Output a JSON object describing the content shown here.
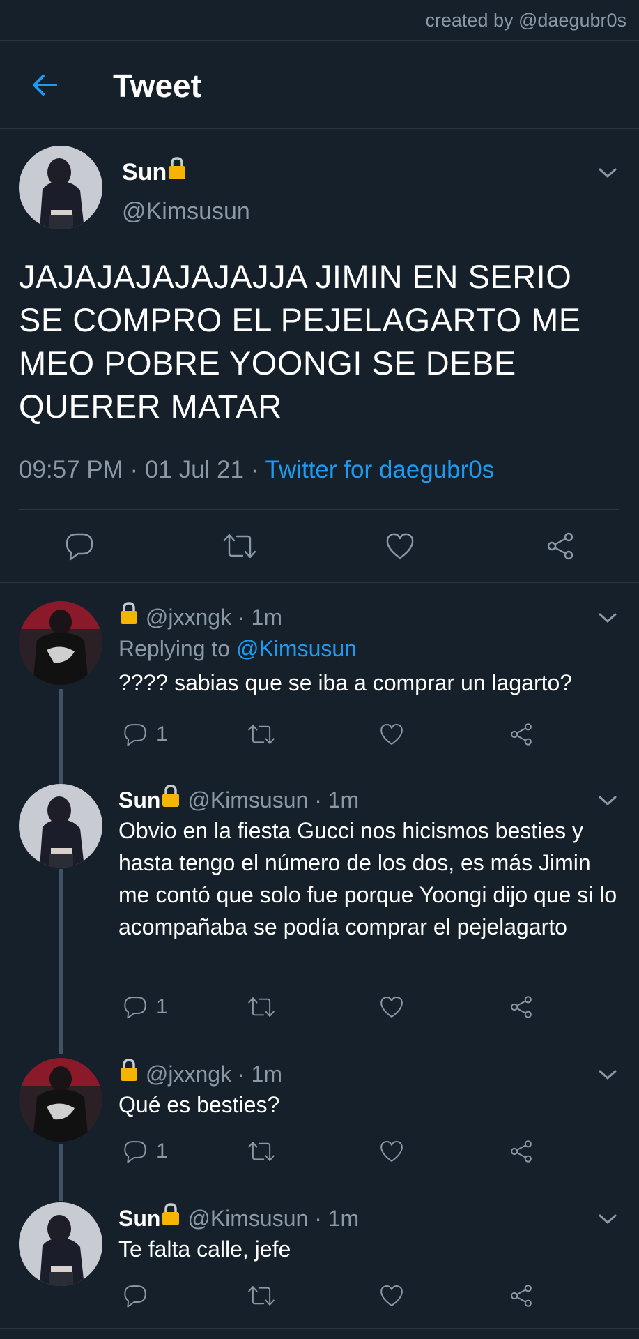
{
  "credit": "created by @daegubr0s",
  "header": {
    "title": "Tweet"
  },
  "main_tweet": {
    "name": "Sun",
    "handle": "@Kimsusun",
    "text": "JAJAJAJAJAJAJJA JIMIN EN SERIO SE COMPRO EL PEJELAGARTO ME MEO POBRE YOONGI SE DEBE QUERER MATAR",
    "time": "09:57 PM",
    "date": "01 Jul 21",
    "source": "Twitter for daegubr0s"
  },
  "replies": [
    {
      "name": "",
      "handle": "@jxxngk",
      "age": "1m",
      "replying_label": "Replying to",
      "replying_to": "@Kimsusun",
      "text": "???? sabias que se iba a comprar un lagarto?",
      "reply_count": "1"
    },
    {
      "name": "Sun",
      "handle": "@Kimsusun",
      "age": "1m",
      "text": "Obvio en la fiesta Gucci nos hicismos besties y hasta tengo el número de los dos, es más Jimin me contó que solo fue porque Yoongi dijo que si lo acompañaba se podía comprar el pejelagarto",
      "reply_count": "1"
    },
    {
      "name": "",
      "handle": "@jxxngk",
      "age": "1m",
      "text": "Qué es besties?",
      "reply_count": "1"
    },
    {
      "name": "Sun",
      "handle": "@Kimsusun",
      "age": "1m",
      "text": "Te falta calle, jefe",
      "reply_count": ""
    }
  ],
  "icons": {
    "back": "arrow-left-icon",
    "lock": "lock-icon",
    "more": "chevron-down-icon",
    "reply": "reply-icon",
    "retweet": "retweet-icon",
    "like": "heart-icon",
    "share": "share-icon"
  },
  "colors": {
    "background": "#15202b",
    "accent": "#1d9bf0",
    "secondary_text": "#8b98a5",
    "lock": "#f5b400"
  }
}
